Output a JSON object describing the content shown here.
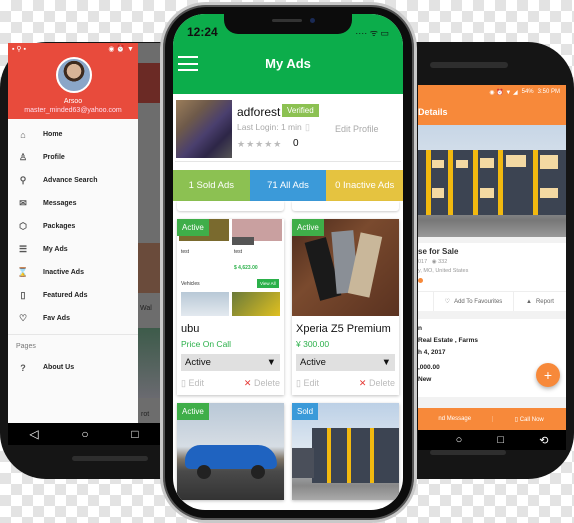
{
  "left_phone": {
    "drawer": {
      "user_name": "Arsoo",
      "user_email": "master_minded63@yahoo.com",
      "items": [
        {
          "label": "Home",
          "icon": "home-icon",
          "glyph": "⌂"
        },
        {
          "label": "Profile",
          "icon": "profile-icon",
          "glyph": "♙"
        },
        {
          "label": "Advance Search",
          "icon": "search-icon",
          "glyph": "⚲"
        },
        {
          "label": "Messages",
          "icon": "mail-icon",
          "glyph": "✉"
        },
        {
          "label": "Packages",
          "icon": "tag-icon",
          "glyph": "⬡"
        },
        {
          "label": "My Ads",
          "icon": "list-icon",
          "glyph": "☰"
        },
        {
          "label": "Inactive Ads",
          "icon": "inactive-icon",
          "glyph": "⌛"
        },
        {
          "label": "Featured Ads",
          "icon": "bookmark-icon",
          "glyph": "▯"
        },
        {
          "label": "Fav Ads",
          "icon": "heart-icon",
          "glyph": "♡"
        }
      ],
      "section_label": "Pages",
      "page_items": [
        {
          "label": "About Us",
          "icon": "help-icon",
          "glyph": "?"
        }
      ]
    },
    "background_label": "Wal",
    "background_label2": "rot",
    "nav": {
      "back": "◁",
      "home": "○",
      "recents": "□"
    }
  },
  "center_phone": {
    "status": {
      "time": "12:24",
      "icons": "···· ᯤ ▭"
    },
    "header": {
      "title": "My Ads"
    },
    "profile": {
      "name": "adforest",
      "verified_label": "Verified",
      "last_login": "Last Login: 1 min",
      "edit_profile": "Edit Profile",
      "stars": "★★★★★",
      "rating_count": "0"
    },
    "stats": {
      "sold": "1 Sold Ads",
      "all": "71 All Ads",
      "inactive": "0 Inactive Ads"
    },
    "ads": [
      {
        "status": "Active",
        "title": "ubu",
        "price": "Price On Call",
        "select_value": "Active",
        "edit": "Edit",
        "delete": "Delete",
        "image": "app-screenshot-mosaic"
      },
      {
        "status": "Active",
        "title": "Xperia Z5 Premium",
        "price": "¥ 300.00",
        "select_value": "Active",
        "edit": "Edit",
        "delete": "Delete",
        "image": "phones-photo"
      },
      {
        "status": "Active",
        "image": "car-photo"
      },
      {
        "status": "Sold",
        "image": "building-photo"
      }
    ],
    "mosaic": {
      "item1_title": "test",
      "item2_title": "test",
      "item2_price": "$ 4,623.00",
      "section": "Vehicles",
      "view_all": "View All"
    },
    "colors": {
      "header_green": "#0cad4b",
      "sold_stat": "#8cc152",
      "all_stat": "#3b9ad9",
      "inactive_stat": "#e5c340",
      "active_badge": "#3fae49",
      "sold_badge": "#3b9ad9",
      "price_green": "#2bb04a",
      "delete_red": "#e53935"
    }
  },
  "right_phone": {
    "status": {
      "battery": "54%",
      "time": "3:50 PM"
    },
    "toolbar_title": "Details",
    "listing": {
      "title": "se  for Sale",
      "date": "017",
      "views": "332",
      "location": "y, MO, United States"
    },
    "actions": {
      "favourite": "Add To Favourites",
      "report": "Report"
    },
    "info": {
      "line1": "n",
      "line2": "Real Estate , Farms",
      "line3": "h 4, 2017",
      "line4": ",000.00",
      "line5": "New"
    },
    "fab_label": "+",
    "bottom_bar": {
      "message": "nd Message",
      "call": "Call Now"
    },
    "colors": {
      "accent": "#f7893a"
    },
    "nav": {
      "home": "○",
      "recents": "□",
      "rotate": "⟲"
    }
  }
}
